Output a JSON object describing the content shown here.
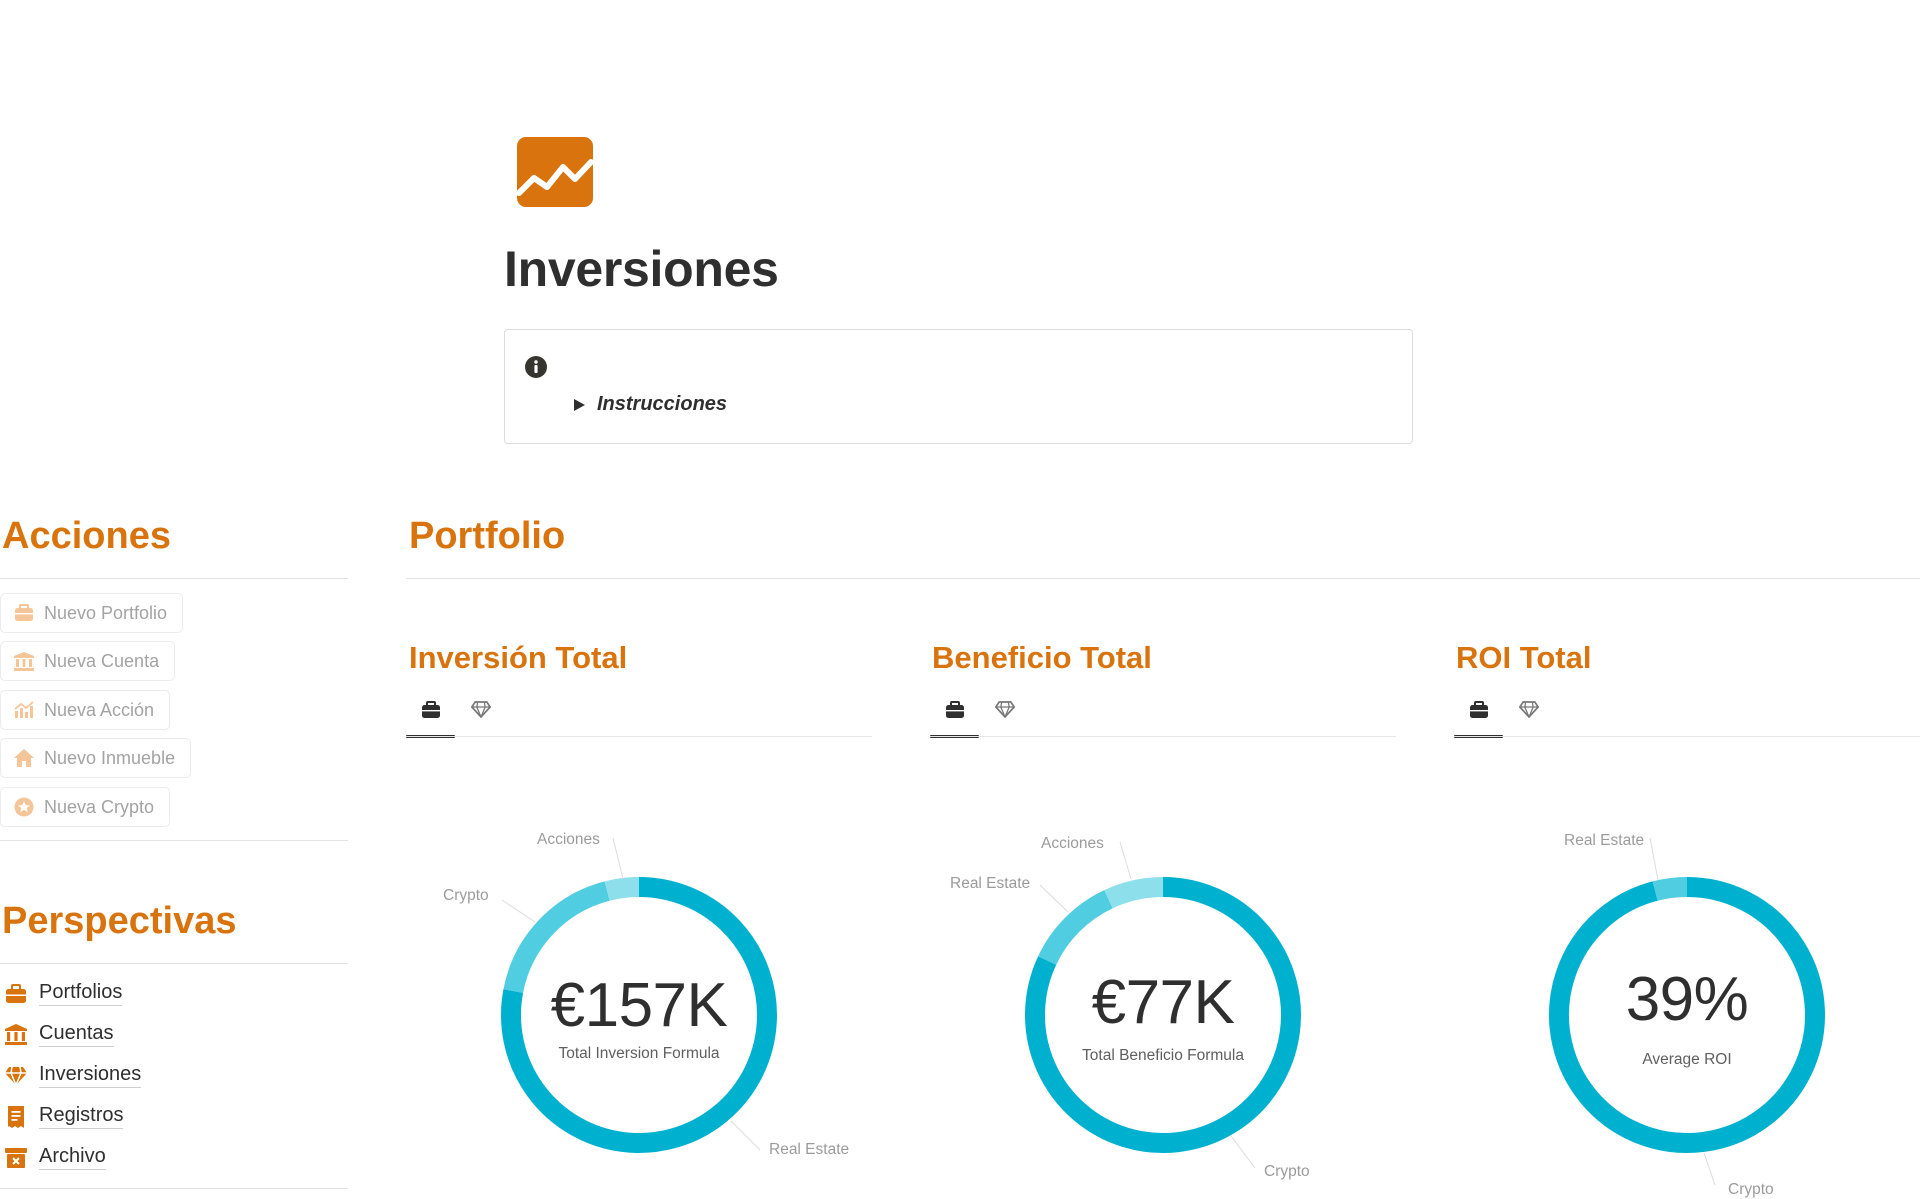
{
  "page": {
    "icon": "chart-line-icon",
    "title": "Inversiones",
    "accent_color": "#d9730d"
  },
  "callout": {
    "icon": "info-circle-icon",
    "toggle_label": "Instrucciones"
  },
  "acciones": {
    "heading": "Acciones",
    "buttons": [
      {
        "label": "Nuevo Portfolio",
        "icon": "briefcase-icon"
      },
      {
        "label": "Nueva Cuenta",
        "icon": "bank-icon"
      },
      {
        "label": "Nueva Acción",
        "icon": "stock-chart-icon"
      },
      {
        "label": "Nuevo Inmueble",
        "icon": "house-icon"
      },
      {
        "label": "Nueva Crypto",
        "icon": "coin-icon"
      }
    ]
  },
  "perspectivas": {
    "heading": "Perspectivas",
    "items": [
      {
        "label": "Portfolios",
        "icon": "briefcase-icon"
      },
      {
        "label": "Cuentas",
        "icon": "bank-icon"
      },
      {
        "label": "Inversiones",
        "icon": "diamond-icon"
      },
      {
        "label": "Registros",
        "icon": "receipt-icon"
      },
      {
        "label": "Archivo",
        "icon": "archive-box-icon"
      }
    ]
  },
  "portfolio": {
    "heading": "Portfolio",
    "colors": {
      "primary": "#00b1cf",
      "secondary": "#50cde0",
      "tertiary": "#8ddfeb"
    },
    "cards": [
      {
        "title": "Inversión Total",
        "tabs": [
          "briefcase-icon",
          "diamond-icon"
        ],
        "value": "€157K",
        "caption": "Total Inversion Formula",
        "slice_labels": [
          "Acciones",
          "Crypto",
          "Real Estate"
        ]
      },
      {
        "title": "Beneficio Total",
        "tabs": [
          "briefcase-icon",
          "diamond-icon"
        ],
        "value": "€77K",
        "caption": "Total Beneficio Formula",
        "slice_labels": [
          "Acciones",
          "Real Estate",
          "Crypto"
        ]
      },
      {
        "title": "ROI Total",
        "tabs": [
          "briefcase-icon",
          "diamond-icon"
        ],
        "value": "39%",
        "caption": "Average ROI",
        "slice_labels": [
          "Real Estate",
          "Crypto"
        ]
      }
    ]
  },
  "chart_data": [
    {
      "type": "pie",
      "title": "Inversión Total",
      "center_value": "€157K",
      "center_label": "Total Inversion Formula",
      "categories": [
        "Real Estate",
        "Crypto",
        "Acciones"
      ],
      "values": [
        78,
        18,
        4
      ]
    },
    {
      "type": "pie",
      "title": "Beneficio Total",
      "center_value": "€77K",
      "center_label": "Total Beneficio Formula",
      "categories": [
        "Crypto",
        "Real Estate",
        "Acciones"
      ],
      "values": [
        82,
        11,
        7
      ]
    },
    {
      "type": "pie",
      "title": "ROI Total",
      "center_value": "39%",
      "center_label": "Average ROI",
      "categories": [
        "Crypto",
        "Real Estate"
      ],
      "values": [
        96,
        4
      ]
    }
  ]
}
